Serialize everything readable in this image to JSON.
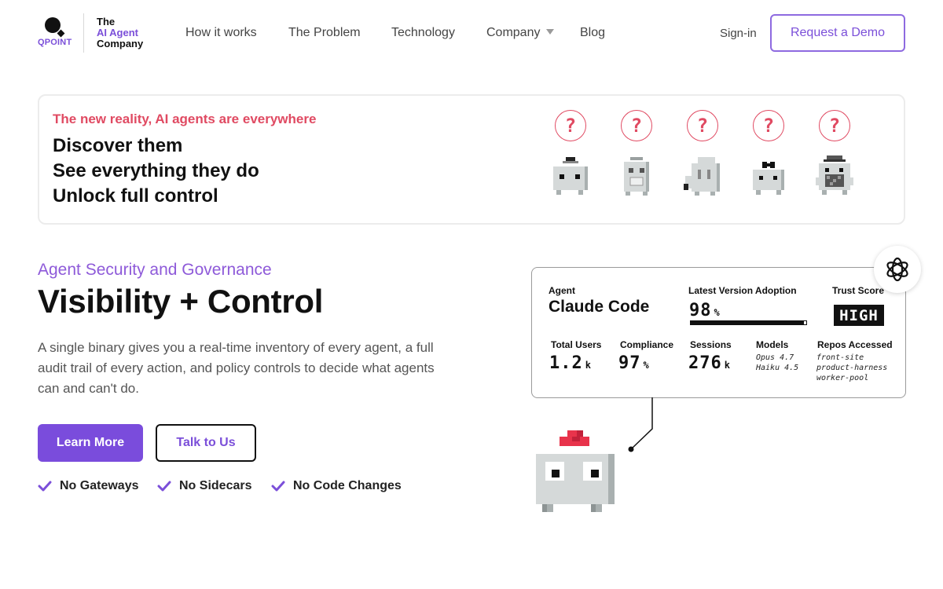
{
  "nav": {
    "logo_text": "QPOINT",
    "tagline": [
      "The",
      "AI Agent",
      "Company"
    ],
    "links": [
      "How it works",
      "The Problem",
      "Technology",
      "Company",
      "Blog"
    ],
    "signin": "Sign-in",
    "demo": "Request a Demo"
  },
  "banner": {
    "kicker": "The new reality, AI agents are everywhere",
    "lines": [
      "Discover them",
      "See everything they do",
      "Unlock full control"
    ],
    "bubble_glyph": "?"
  },
  "hero": {
    "eyebrow": "Agent Security and Governance",
    "title": "Visibility + Control",
    "description": "A single binary gives you a real-time inventory of every agent, a full audit trail of every action, and policy controls to decide what agents can and can't do.",
    "learn_more": "Learn More",
    "talk": "Talk to Us",
    "features": [
      "No Gateways",
      "No Sidecars",
      "No Code Changes"
    ]
  },
  "card": {
    "agent_label": "Agent",
    "agent_name": "Claude Code",
    "adoption_label": "Latest Version Adoption",
    "adoption_value": "98",
    "adoption_unit": "%",
    "adoption_fraction": 0.98,
    "trust_label": "Trust Score",
    "trust_value": "HIGH",
    "users_label": "Total Users",
    "users_value": "1.2",
    "users_unit": "k",
    "compliance_label": "Compliance",
    "compliance_value": "97",
    "compliance_unit": "%",
    "sessions_label": "Sessions",
    "sessions_value": "276",
    "sessions_unit": "k",
    "models_label": "Models",
    "models": [
      "Opus 4.7",
      "Haiku 4.5"
    ],
    "repos_label": "Repos Accessed",
    "repos": [
      "front-site",
      "product-harness",
      "worker-pool"
    ]
  },
  "colors": {
    "brand": "#7b4fd9",
    "button": "#7a4cdc",
    "alert": "#e04a62",
    "robot_body": "#d5d9d9",
    "robot_hat": "#e8334b"
  },
  "icons": [
    "qpoint-logo-icon",
    "chevron-down-icon",
    "question-icon",
    "check-icon",
    "openai-logo-icon"
  ]
}
